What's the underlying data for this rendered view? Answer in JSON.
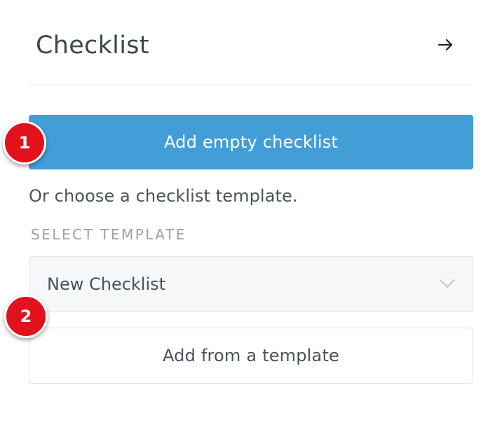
{
  "panel": {
    "title": "Checklist",
    "close_icon": "arrow-right-icon"
  },
  "primary_button": {
    "label": "Add empty checklist",
    "color": "#439ed8"
  },
  "hint_text": "Or choose a checklist template.",
  "template_select": {
    "label": "SELECT TEMPLATE",
    "selected_value": "New Checklist",
    "icon": "chevron-down-icon"
  },
  "secondary_button": {
    "label": "Add from a template"
  },
  "markers": [
    {
      "label": "1",
      "color": "#e1121c"
    },
    {
      "label": "2",
      "color": "#e1121c"
    }
  ]
}
